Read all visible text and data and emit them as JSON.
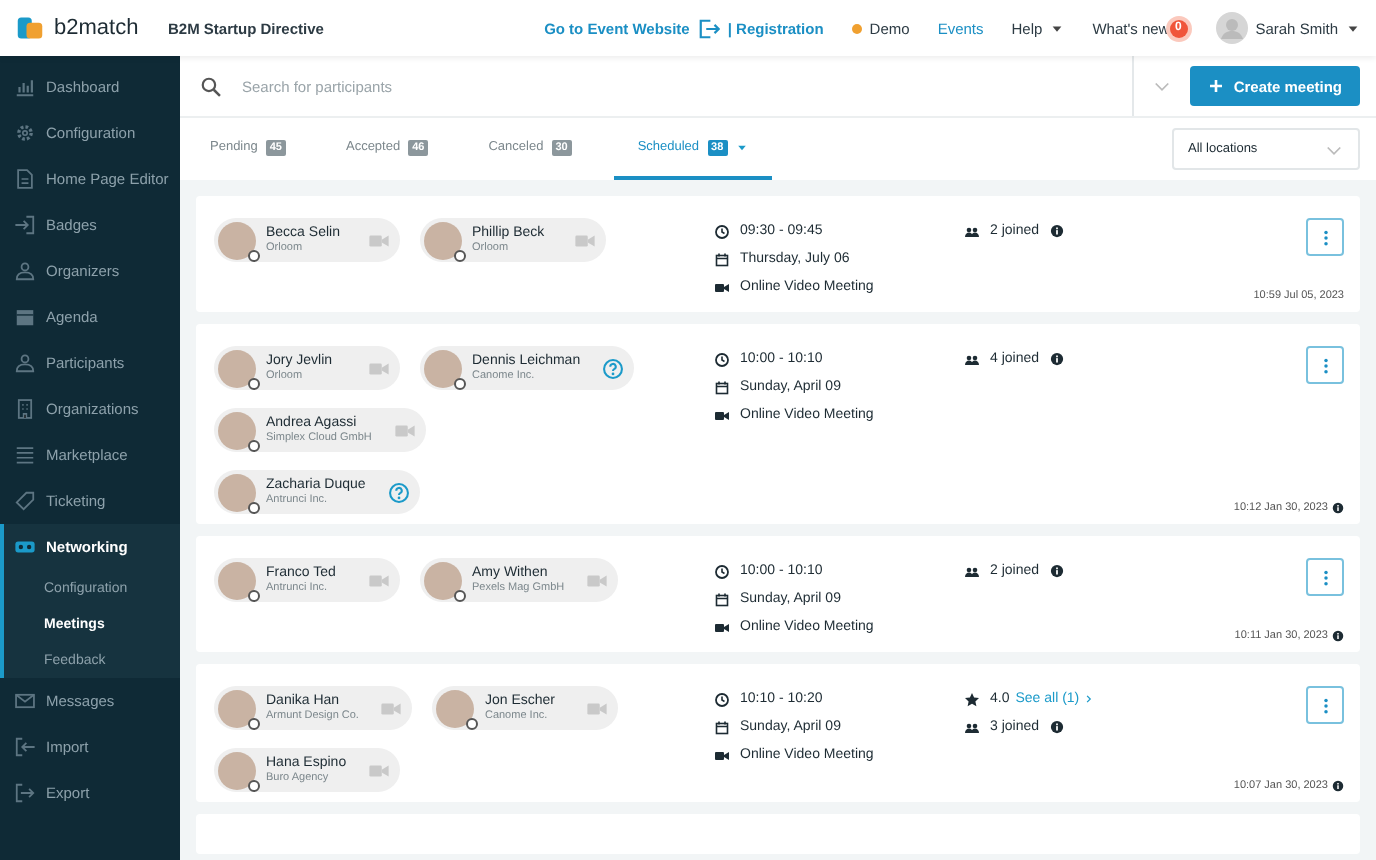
{
  "header": {
    "logo": "b2match",
    "event_title": "B2M Startup Directive",
    "links": [
      {
        "kind": "link",
        "label": "Go to Event Website"
      },
      {
        "kind": "link",
        "label": "| Registration"
      },
      {
        "kind": "status",
        "label": "Demo",
        "color": "#f0a030"
      },
      {
        "kind": "nav",
        "label": "Events"
      },
      {
        "kind": "menu",
        "label": "Help"
      },
      {
        "kind": "news",
        "label": "What's new",
        "badge": "0"
      }
    ],
    "user": {
      "name": "Sarah Smith"
    }
  },
  "sidebar": {
    "items": [
      {
        "label": "Dashboard",
        "selected": false
      },
      {
        "label": "Configuration",
        "selected": false
      },
      {
        "label": "Home Page Editor",
        "selected": false
      },
      {
        "label": "Badges",
        "selected": false
      },
      {
        "label": "Organizers",
        "selected": false
      },
      {
        "label": "Agenda",
        "selected": false
      },
      {
        "label": "Participants",
        "selected": false
      },
      {
        "label": "Organizations",
        "selected": false
      },
      {
        "label": "Marketplace",
        "selected": false
      },
      {
        "label": "Ticketing",
        "selected": false
      },
      {
        "label": "Networking",
        "selected": true,
        "children": [
          {
            "label": "Configuration",
            "selected": false
          },
          {
            "label": "Meetings",
            "selected": true
          },
          {
            "label": "Feedback",
            "selected": false
          }
        ]
      },
      {
        "label": "Messages",
        "selected": false
      },
      {
        "label": "Import",
        "selected": false
      },
      {
        "label": "Export",
        "selected": false
      }
    ]
  },
  "search": {
    "placeholder": "Search for participants"
  },
  "create_button": "Create meeting",
  "tabs": [
    {
      "label": "Pending",
      "count": "45",
      "selected": false,
      "dropdown": false
    },
    {
      "label": "Accepted",
      "count": "46",
      "selected": false,
      "dropdown": false
    },
    {
      "label": "Canceled",
      "count": "30",
      "selected": false,
      "dropdown": false
    },
    {
      "label": "Scheduled",
      "count": "38",
      "selected": true,
      "dropdown": true
    }
  ],
  "location_filter": "All locations",
  "meetings": [
    {
      "participants": [
        {
          "name": "Becca Selin",
          "company": "Orloom",
          "kind": "video"
        },
        {
          "name": "Phillip Beck",
          "company": "Orloom",
          "kind": "video"
        }
      ],
      "time": "09:30 - 09:45",
      "date": "Thursday, July 06",
      "location": "Online Video Meeting",
      "joined": "2 joined",
      "created": "10:59 Jul 05, 2023",
      "created_info": false
    },
    {
      "participants": [
        {
          "name": "Jory Jevlin",
          "company": "Orloom",
          "kind": "video"
        },
        {
          "name": "Dennis Leichman",
          "company": "Canome Inc.",
          "kind": "question"
        },
        {
          "name": "Andrea Agassi",
          "company": "Simplex Cloud GmbH",
          "kind": "video"
        },
        {
          "name": "Zacharia Duque",
          "company": "Antrunci Inc.",
          "kind": "question"
        }
      ],
      "time": "10:00 - 10:10",
      "date": "Sunday, April 09",
      "location": "Online Video Meeting",
      "joined": "4 joined",
      "created": "10:12 Jan 30, 2023",
      "created_info": true
    },
    {
      "participants": [
        {
          "name": "Franco Ted",
          "company": "Antrunci Inc.",
          "kind": "video"
        },
        {
          "name": "Amy Withen",
          "company": "Pexels Mag GmbH",
          "kind": "video"
        }
      ],
      "time": "10:00 - 10:10",
      "date": "Sunday, April 09",
      "location": "Online Video Meeting",
      "joined": "2 joined",
      "created": "10:11 Jan 30, 2023",
      "created_info": true
    },
    {
      "participants": [
        {
          "name": "Danika Han",
          "company": "Armunt Design Co.",
          "kind": "video"
        },
        {
          "name": "Jon Escher",
          "company": "Canome Inc.",
          "kind": "video"
        },
        {
          "name": "Hana Espino",
          "company": "Buro Agency",
          "kind": "video"
        }
      ],
      "time": "10:10 - 10:20",
      "date": "Sunday, April 09",
      "location": "Online Video Meeting",
      "rating": {
        "value": "4.0",
        "link": "See all (1)"
      },
      "joined": "3 joined",
      "created": "10:07 Jan 30, 2023",
      "created_info": true
    }
  ]
}
